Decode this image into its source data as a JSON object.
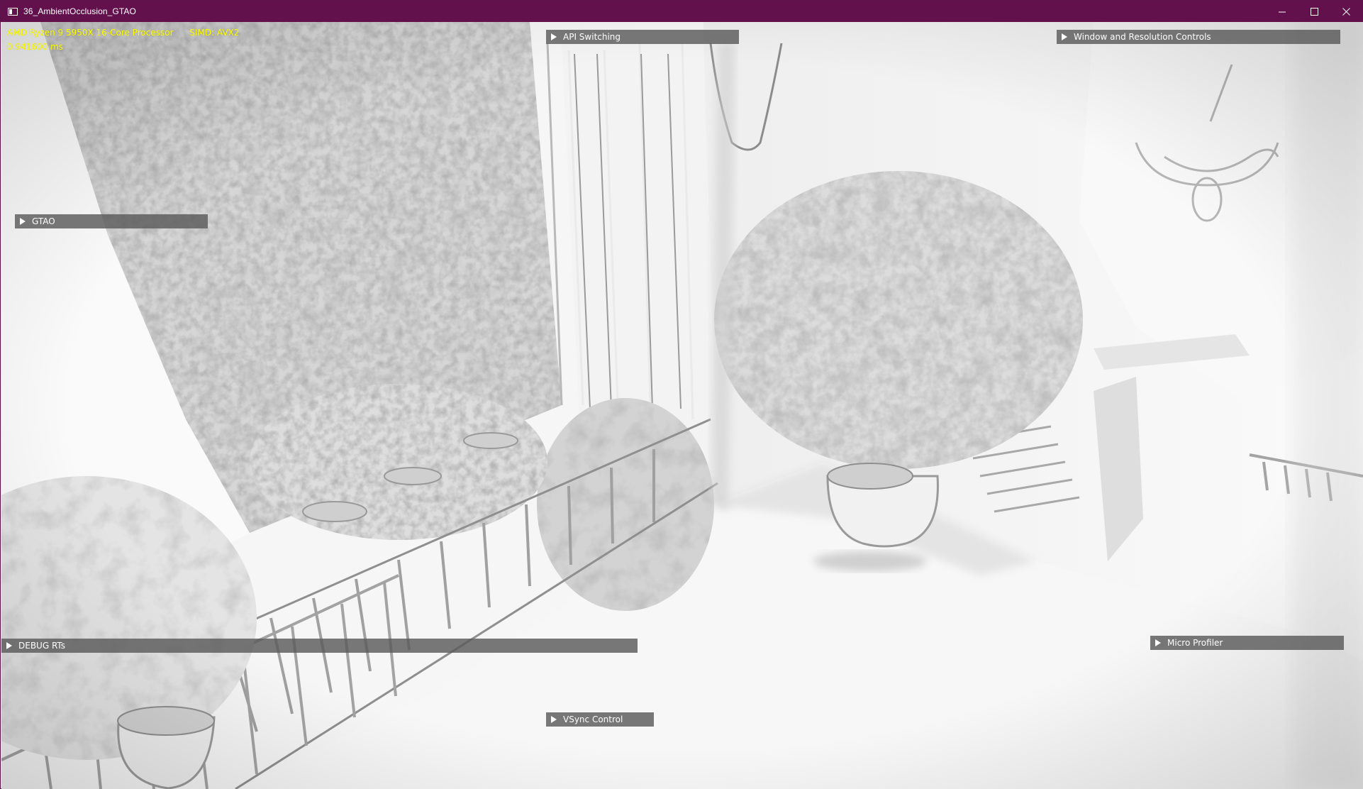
{
  "window": {
    "title": "36_AmbientOcclusion_GTAO",
    "minimize_icon": "minimize-icon",
    "maximize_icon": "maximize-icon",
    "close_icon": "close-icon"
  },
  "hud": {
    "cpu_line": "AMD Ryzen 9 5950X 16-Core Processor      SIMD: AVX2",
    "frame_time": "0.941600 ms",
    "color": "#ffff00"
  },
  "panels": {
    "api_switching": "API Switching",
    "window_resolution": "Window and Resolution Controls",
    "gtao": "GTAO",
    "debug_rts": "DEBUG RTs",
    "micro_profiler": "Micro Profiler",
    "vsync_control": "VSync Control"
  },
  "colors": {
    "titlebar": "#62114d",
    "panel": "#5a5a5a",
    "hud_text": "#ffff00"
  }
}
